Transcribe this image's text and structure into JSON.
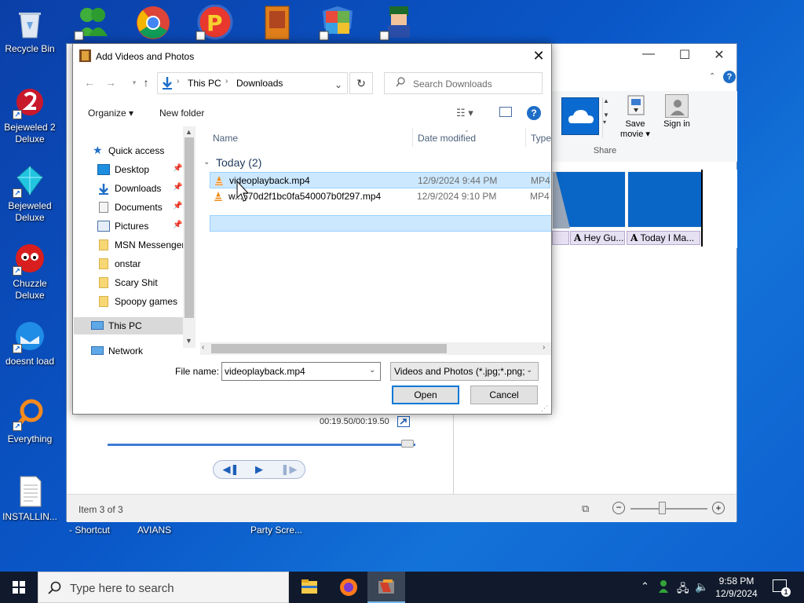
{
  "desktop": {
    "icons": [
      {
        "label": "Recycle Bin"
      },
      {
        "label": "Bejeweled 2 Deluxe"
      },
      {
        "label": "Bejeweled Deluxe"
      },
      {
        "label": "Chuzzle Deluxe"
      },
      {
        "label": "doesnt load"
      },
      {
        "label": "Everything"
      },
      {
        "label": "INSTALLIN..."
      }
    ],
    "partial_labels": [
      "- Shortcut",
      "AVIANS",
      "Party Scre..."
    ]
  },
  "app_window": {
    "share_group_label": "Share",
    "save_movie_label": "Save movie ▾",
    "sign_in_label": "Sign in",
    "captions": [
      "Hey Gu...",
      "Today I Ma..."
    ],
    "time_readout": "00:19.50/00:19.50",
    "status_text": "Item 3 of 3",
    "seek_progress": 1.0
  },
  "dialog": {
    "title": "Add Videos and Photos",
    "breadcrumb": [
      "This PC",
      "Downloads"
    ],
    "search_placeholder": "Search Downloads",
    "organize_label": "Organize ▾",
    "new_folder_label": "New folder",
    "nav": {
      "quick_access": "Quick access",
      "items": [
        {
          "label": "Desktop",
          "pinned": true
        },
        {
          "label": "Downloads",
          "pinned": true
        },
        {
          "label": "Documents",
          "pinned": true
        },
        {
          "label": "Pictures",
          "pinned": true
        },
        {
          "label": "MSN Messenger",
          "pinned": false
        },
        {
          "label": "onstar",
          "pinned": false
        },
        {
          "label": "Scary Shit",
          "pinned": false
        },
        {
          "label": "Spoopy games",
          "pinned": false
        }
      ],
      "this_pc": "This PC",
      "network": "Network"
    },
    "columns": {
      "name": "Name",
      "date": "Date modified",
      "type": "Type"
    },
    "group": "Today (2)",
    "files": [
      {
        "name": "videoplayback.mp4",
        "date": "12/9/2024 9:44 PM",
        "type": "MP4",
        "selected": true
      },
      {
        "name": "w...670d2f1bc0fa540007b0f297.mp4",
        "date": "12/9/2024 9:10 PM",
        "type": "MP4",
        "selected": false
      }
    ],
    "filename_label": "File name:",
    "filename_value": "videoplayback.mp4",
    "filetype_value": "Videos and Photos (*.jpg;*.png;",
    "open_label": "Open",
    "cancel_label": "Cancel"
  },
  "taskbar": {
    "search_placeholder": "Type here to search",
    "time": "9:58 PM",
    "date": "12/9/2024",
    "notification_count": "1"
  },
  "colors": {
    "accent": "#0078d7",
    "selection": "#cce8ff",
    "desktop_blue": "#0a57c8",
    "taskbar": "#101a2c"
  }
}
